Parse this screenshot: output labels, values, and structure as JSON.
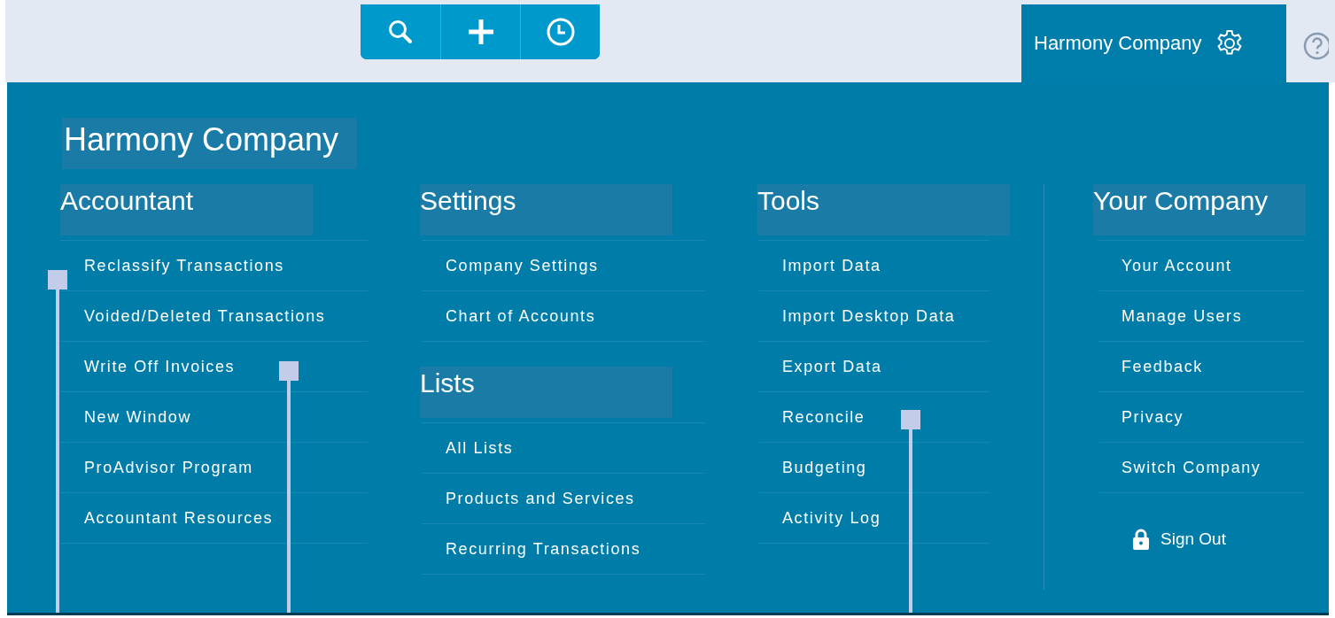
{
  "top_bar": {
    "company_menu": {
      "label": "Harmony Company",
      "expanded": true
    }
  },
  "menu": {
    "title": "Harmony Company",
    "columns": [
      {
        "groups": [
          {
            "heading": "Accountant",
            "items": [
              "Reclassify Transactions",
              "Voided/Deleted Transactions",
              "Write Off Invoices",
              "New Window",
              "ProAdvisor Program",
              "Accountant Resources"
            ]
          }
        ]
      },
      {
        "groups": [
          {
            "heading": "Settings",
            "items": [
              "Company Settings",
              "Chart of Accounts"
            ]
          },
          {
            "heading": "Lists",
            "items": [
              "All Lists",
              "Products and Services",
              "Recurring Transactions"
            ]
          }
        ]
      },
      {
        "groups": [
          {
            "heading": "Tools",
            "items": [
              "Import Data",
              "Import Desktop Data",
              "Export Data",
              "Reconcile",
              "Budgeting",
              "Activity Log"
            ]
          }
        ]
      },
      {
        "groups": [
          {
            "heading": "Your Company",
            "items": [
              "Your Account",
              "Manage Users",
              "Feedback",
              "Privacy",
              "Switch Company"
            ]
          }
        ],
        "sign_out": "Sign Out"
      }
    ]
  }
}
